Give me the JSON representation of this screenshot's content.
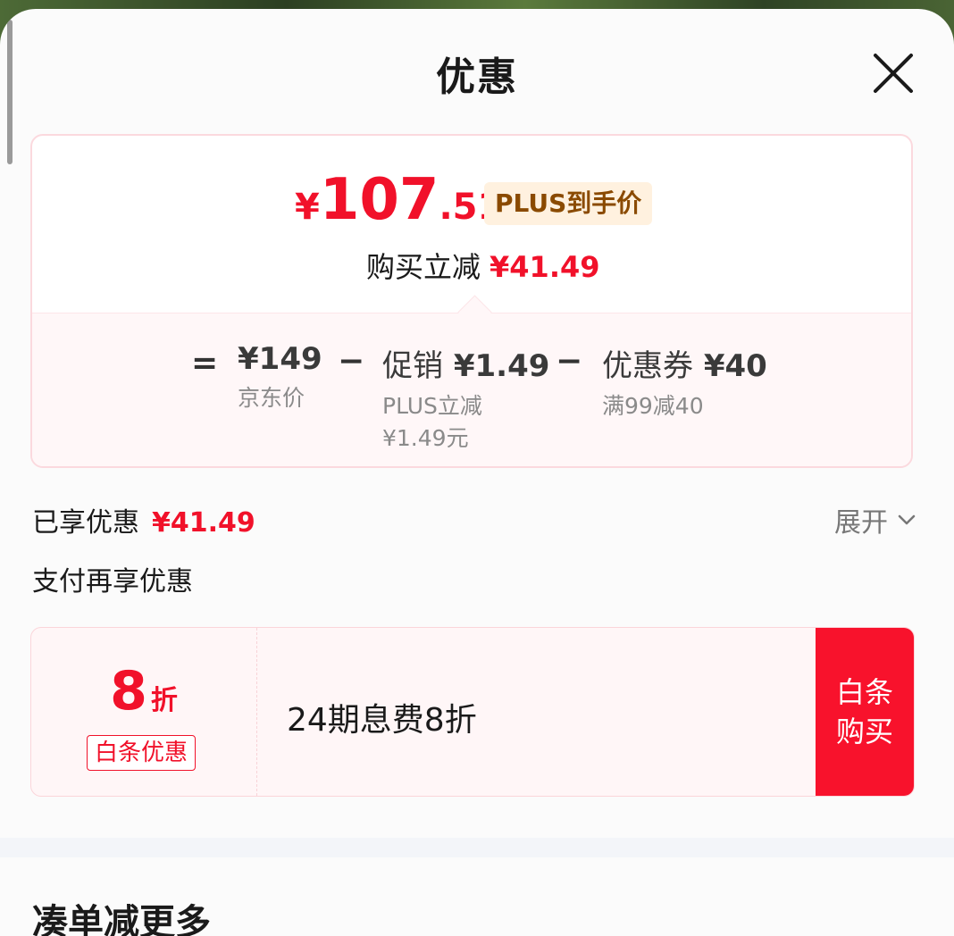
{
  "header": {
    "title": "优惠"
  },
  "price_summary": {
    "currency_symbol": "¥",
    "price_integer": "107",
    "price_decimal_dot": ".",
    "price_decimal": "51",
    "plus_badge": "PLUS到手价",
    "instant_off_label": "购买立减",
    "instant_off_amount": "¥41.49"
  },
  "breakdown": {
    "equals": "=",
    "minus": "−",
    "jd_price": {
      "amount": "¥149",
      "label": "京东价"
    },
    "promotion": {
      "label": "促销",
      "amount": "¥1.49",
      "sub_line1": "PLUS立减",
      "sub_line2": "¥1.49元"
    },
    "coupon": {
      "label": "优惠券",
      "amount": "¥40",
      "sub": "满99减40"
    }
  },
  "enjoyed": {
    "label": "已享优惠",
    "amount": "¥41.49",
    "expand_label": "展开"
  },
  "payment": {
    "title": "支付再享优惠",
    "baitiao": {
      "discount_number": "8",
      "discount_unit": "折",
      "tag": "白条优惠",
      "description": "24期息费8折",
      "button_label": "白条购买"
    }
  },
  "more_section": {
    "title": "凑单减更多"
  },
  "colors": {
    "accent_red": "#f1112a",
    "plus_badge_bg": "#fff1df",
    "plus_badge_text": "#8a4a00"
  }
}
